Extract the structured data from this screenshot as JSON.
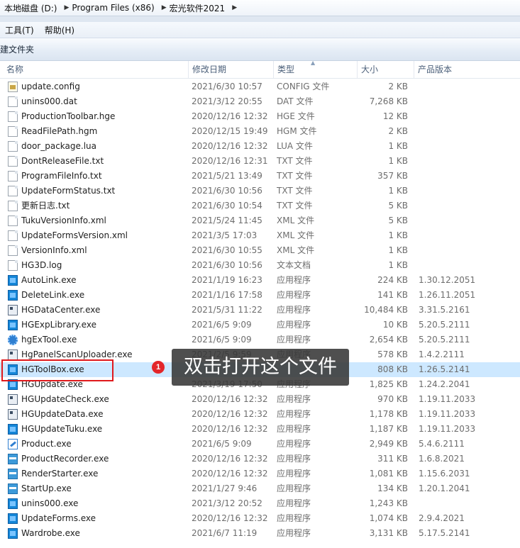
{
  "address": {
    "crumbs": [
      "本地磁盘 (D:)",
      "Program Files (x86)",
      "宏光软件2021"
    ]
  },
  "menu": {
    "items": [
      "工具(T)",
      "帮助(H)"
    ]
  },
  "toolbar": {
    "new_folder_label": "新建文件夹"
  },
  "columns": {
    "name": "名称",
    "date": "修改日期",
    "type": "类型",
    "size": "大小",
    "version": "产品版本"
  },
  "files": [
    {
      "name": "update.config",
      "date": "2021/6/30 10:57",
      "type": "CONFIG 文件",
      "size": "2 KB",
      "version": "",
      "icon": "config-file-icon"
    },
    {
      "name": "unins000.dat",
      "date": "2021/3/12 20:55",
      "type": "DAT 文件",
      "size": "7,268 KB",
      "version": "",
      "icon": "file-icon"
    },
    {
      "name": "ProductionToolbar.hge",
      "date": "2020/12/16 12:32",
      "type": "HGE 文件",
      "size": "12 KB",
      "version": "",
      "icon": "file-icon"
    },
    {
      "name": "ReadFilePath.hgm",
      "date": "2020/12/15 19:49",
      "type": "HGM 文件",
      "size": "2 KB",
      "version": "",
      "icon": "file-icon"
    },
    {
      "name": "door_package.lua",
      "date": "2020/12/16 12:32",
      "type": "LUA 文件",
      "size": "1 KB",
      "version": "",
      "icon": "file-icon"
    },
    {
      "name": "DontReleaseFile.txt",
      "date": "2020/12/16 12:31",
      "type": "TXT 文件",
      "size": "1 KB",
      "version": "",
      "icon": "file-icon"
    },
    {
      "name": "ProgramFileInfo.txt",
      "date": "2021/5/21 13:49",
      "type": "TXT 文件",
      "size": "357 KB",
      "version": "",
      "icon": "file-icon"
    },
    {
      "name": "UpdateFormStatus.txt",
      "date": "2021/6/30 10:56",
      "type": "TXT 文件",
      "size": "1 KB",
      "version": "",
      "icon": "file-icon"
    },
    {
      "name": "更新日志.txt",
      "date": "2021/6/30 10:54",
      "type": "TXT 文件",
      "size": "5 KB",
      "version": "",
      "icon": "file-icon"
    },
    {
      "name": "TukuVersionInfo.xml",
      "date": "2021/5/24 11:45",
      "type": "XML 文件",
      "size": "5 KB",
      "version": "",
      "icon": "file-icon"
    },
    {
      "name": "UpdateFormsVersion.xml",
      "date": "2021/3/5 17:03",
      "type": "XML 文件",
      "size": "1 KB",
      "version": "",
      "icon": "file-icon"
    },
    {
      "name": "VersionInfo.xml",
      "date": "2021/6/30 10:55",
      "type": "XML 文件",
      "size": "1 KB",
      "version": "",
      "icon": "file-icon"
    },
    {
      "name": "HG3D.log",
      "date": "2021/6/30 10:56",
      "type": "文本文档",
      "size": "1 KB",
      "version": "",
      "icon": "file-icon"
    },
    {
      "name": "AutoLink.exe",
      "date": "2021/1/19 16:23",
      "type": "应用程序",
      "size": "224 KB",
      "version": "1.30.12.2051",
      "icon": "app-icon"
    },
    {
      "name": "DeleteLink.exe",
      "date": "2021/1/16 17:58",
      "type": "应用程序",
      "size": "141 KB",
      "version": "1.26.11.2051",
      "icon": "app-icon"
    },
    {
      "name": "HGDataCenter.exe",
      "date": "2021/5/31 11:22",
      "type": "应用程序",
      "size": "10,484 KB",
      "version": "3.31.5.2161",
      "icon": "dark-app-icon"
    },
    {
      "name": "HGExpLibrary.exe",
      "date": "2021/6/5 9:09",
      "type": "应用程序",
      "size": "10 KB",
      "version": "5.20.5.2111",
      "icon": "app-icon"
    },
    {
      "name": "hgExTool.exe",
      "date": "2021/6/5 9:09",
      "type": "应用程序",
      "size": "2,654 KB",
      "version": "5.20.5.2111",
      "icon": "gear-icon"
    },
    {
      "name": "HgPanelScanUploader.exe",
      "date": "2021/2/5 9:59",
      "type": "应用程序",
      "size": "578 KB",
      "version": "1.4.2.2111",
      "icon": "dark-app-icon"
    },
    {
      "name": "HGToolBox.exe",
      "date": "",
      "type": "",
      "size": "808 KB",
      "version": "1.26.5.2141",
      "icon": "app-icon"
    },
    {
      "name": "HGUpdate.exe",
      "date": "2021/3/19 17:50",
      "type": "应用程序",
      "size": "1,825 KB",
      "version": "1.24.2.2041",
      "icon": "app-icon"
    },
    {
      "name": "HGUpdateCheck.exe",
      "date": "2020/12/16 12:32",
      "type": "应用程序",
      "size": "970 KB",
      "version": "1.19.11.2033",
      "icon": "dark-app-icon"
    },
    {
      "name": "HGUpdateData.exe",
      "date": "2020/12/16 12:32",
      "type": "应用程序",
      "size": "1,178 KB",
      "version": "1.19.11.2033",
      "icon": "dark-app-icon"
    },
    {
      "name": "HGUpdateTuku.exe",
      "date": "2020/12/16 12:32",
      "type": "应用程序",
      "size": "1,187 KB",
      "version": "1.19.11.2033",
      "icon": "app-icon"
    },
    {
      "name": "Product.exe",
      "date": "2021/6/5 9:09",
      "type": "应用程序",
      "size": "2,949 KB",
      "version": "5.4.6.2111",
      "icon": "tool-icon"
    },
    {
      "name": "ProductRecorder.exe",
      "date": "2020/12/16 12:32",
      "type": "应用程序",
      "size": "311 KB",
      "version": "1.6.8.2021",
      "icon": "badge-app-icon"
    },
    {
      "name": "RenderStarter.exe",
      "date": "2020/12/16 12:32",
      "type": "应用程序",
      "size": "1,081 KB",
      "version": "1.15.6.2031",
      "icon": "badge-app-icon"
    },
    {
      "name": "StartUp.exe",
      "date": "2021/1/27 9:46",
      "type": "应用程序",
      "size": "134 KB",
      "version": "1.20.1.2041",
      "icon": "badge-app-icon"
    },
    {
      "name": "unins000.exe",
      "date": "2021/3/12 20:52",
      "type": "应用程序",
      "size": "1,243 KB",
      "version": "",
      "icon": "app-icon"
    },
    {
      "name": "UpdateForms.exe",
      "date": "2020/12/16 12:32",
      "type": "应用程序",
      "size": "1,074 KB",
      "version": "2.9.4.2021",
      "icon": "app-icon"
    },
    {
      "name": "Wardrobe.exe",
      "date": "2021/6/7 11:19",
      "type": "应用程序",
      "size": "3,131 KB",
      "version": "5.17.5.2141",
      "icon": "app-icon"
    }
  ],
  "annotation": {
    "step_number": "1",
    "tooltip_text": "双击打开这个文件",
    "highlight_color": "#e0191c"
  },
  "colors": {
    "selected_row": "#cde8ff",
    "header_text": "#4c607a"
  }
}
